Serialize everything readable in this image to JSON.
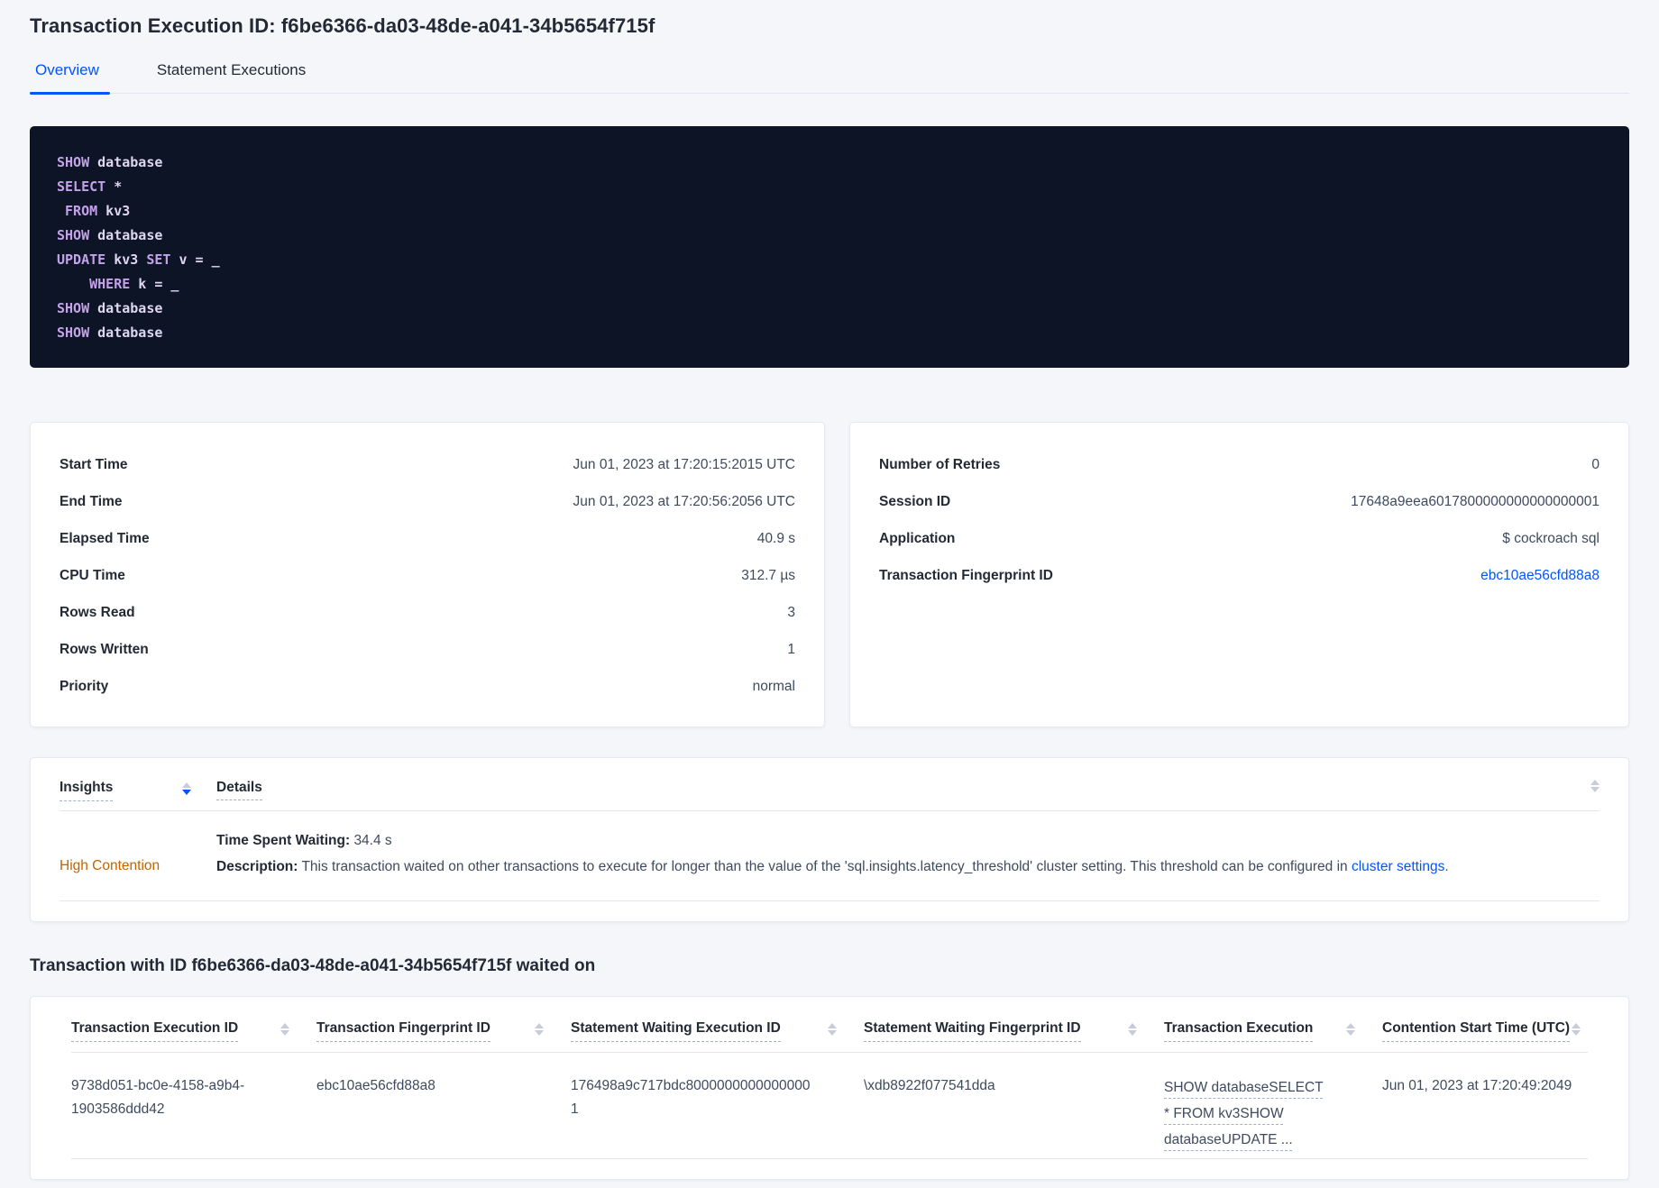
{
  "header": {
    "title": "Transaction Execution ID: f6be6366-da03-48de-a041-34b5654f715f",
    "tabs": [
      {
        "label": "Overview"
      },
      {
        "label": "Statement Executions"
      }
    ]
  },
  "sql_box": {
    "lines": [
      {
        "tokens": [
          {
            "v": "SHOW"
          },
          {
            "v": " database"
          }
        ]
      },
      {
        "tokens": [
          {
            "v": "SELECT"
          },
          {
            "v": " *"
          }
        ]
      },
      {
        "tokens": [
          {
            "v": " FROM"
          },
          {
            "v": " kv3"
          }
        ]
      },
      {
        "tokens": [
          {
            "v": "SHOW"
          },
          {
            "v": " database"
          }
        ]
      },
      {
        "tokens": [
          {
            "v": "UPDATE"
          },
          {
            "v": " kv3 "
          },
          {
            "v": "SET"
          },
          {
            "v": " v = _"
          }
        ]
      },
      {
        "tokens": [
          {
            "v": "    WHERE"
          },
          {
            "v": " k = _"
          }
        ]
      },
      {
        "tokens": [
          {
            "v": "SHOW"
          },
          {
            "v": " database"
          }
        ]
      },
      {
        "tokens": [
          {
            "v": "SHOW"
          },
          {
            "v": " database"
          }
        ]
      }
    ]
  },
  "overview_stats": {
    "left": {
      "rows": [
        {
          "label": "Start Time",
          "value": "Jun 01, 2023 at 17:20:15:2015 UTC"
        },
        {
          "label": "End Time",
          "value": "Jun 01, 2023 at 17:20:56:2056 UTC"
        },
        {
          "label": "Elapsed Time",
          "value": "40.9 s"
        },
        {
          "label": "CPU Time",
          "value": "312.7 µs"
        },
        {
          "label": "Rows Read",
          "value": "3"
        },
        {
          "label": "Rows Written",
          "value": "1"
        },
        {
          "label": "Priority",
          "value": "normal"
        }
      ]
    },
    "right": {
      "rows": [
        {
          "label": "Number of Retries",
          "value": "0"
        },
        {
          "label": "Session ID",
          "value": "17648a9eea6017800000000000000001"
        },
        {
          "label": "Application",
          "value": "$ cockroach sql"
        },
        {
          "label": "Transaction Fingerprint ID",
          "value": "ebc10ae56cfd88a8"
        }
      ]
    }
  },
  "insights_table": {
    "columns": [
      {
        "label": "Insights"
      },
      {
        "label": "Details"
      }
    ],
    "row": {
      "insight": "High Contention",
      "waiting_label": "Time Spent Waiting:",
      "waiting_value": "34.4 s",
      "description_label": "Description:",
      "description_text": "This transaction waited on other transactions to execute for longer than the value of the 'sql.insights.latency_threshold' cluster setting. This threshold can be configured in",
      "description_link": "cluster settings",
      "description_suffix": "."
    }
  },
  "waited_on": {
    "heading": "Transaction with ID f6be6366-da03-48de-a041-34b5654f715f waited on",
    "columns": [
      {
        "label": "Transaction Execution ID"
      },
      {
        "label": "Transaction Fingerprint ID"
      },
      {
        "label": "Statement Waiting Execution ID"
      },
      {
        "label": "Statement Waiting Fingerprint ID"
      },
      {
        "label": "Transaction Execution"
      },
      {
        "label": "Contention Start Time (UTC)"
      }
    ],
    "rows": [
      {
        "transaction_execution_id": "9738d051-bc0e-4158-a9b4-1903586ddd42",
        "transaction_fingerprint_id": "ebc10ae56cfd88a8",
        "statement_waiting_execution_id": "176498a9c717bdc80000000000000001",
        "statement_waiting_fingerprint_id": "\\xdb8922f077541dda",
        "transaction_execution": "SHOW databaseSELECT * FROM kv3SHOW databaseUPDATE ...",
        "contention_start_time": "Jun 01, 2023 at 17:20:49:2049"
      }
    ]
  },
  "colors": {
    "accent_blue": "#0055FF",
    "insight_orange": "#C26400",
    "code_background": "#0D1426",
    "code_keyword": "#C4A2EA"
  }
}
